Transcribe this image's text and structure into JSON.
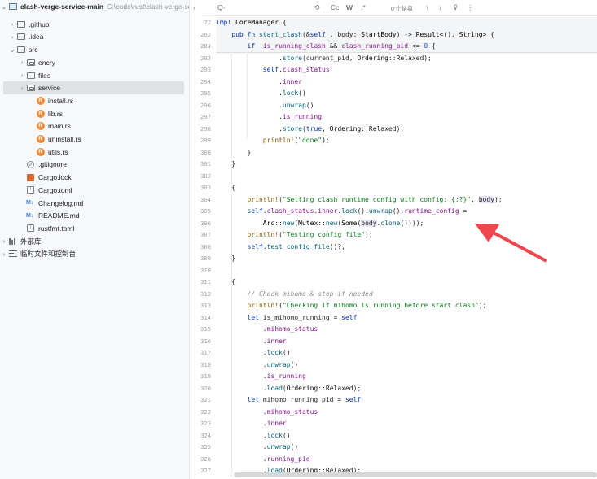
{
  "sidebar": {
    "root": {
      "label": "clash-verge-service-main",
      "path": "G:\\code\\rust\\clash-verge-se"
    },
    "items": [
      {
        "label": ".github",
        "kind": "folder",
        "depth": 1,
        "chevron": "›",
        "icon": "folder-icon"
      },
      {
        "label": ".idea",
        "kind": "folder",
        "depth": 1,
        "chevron": "›",
        "icon": "folder-icon"
      },
      {
        "label": "src",
        "kind": "folder",
        "depth": 1,
        "chevron": "⌄",
        "icon": "folder-icon"
      },
      {
        "label": "encry",
        "kind": "folder",
        "depth": 2,
        "chevron": "›",
        "icon": "package-icon"
      },
      {
        "label": "files",
        "kind": "folder",
        "depth": 2,
        "chevron": "›",
        "icon": "folder-icon"
      },
      {
        "label": "service",
        "kind": "folder",
        "depth": 2,
        "chevron": "›",
        "icon": "package-icon",
        "selected": true
      },
      {
        "label": "install.rs",
        "kind": "rust",
        "depth": 3,
        "icon": "rust-file-icon"
      },
      {
        "label": "lib.rs",
        "kind": "rust",
        "depth": 3,
        "icon": "rust-file-icon"
      },
      {
        "label": "main.rs",
        "kind": "rust",
        "depth": 3,
        "icon": "rust-file-icon"
      },
      {
        "label": "uninstall.rs",
        "kind": "rust",
        "depth": 3,
        "icon": "rust-file-icon"
      },
      {
        "label": "utils.rs",
        "kind": "rust",
        "depth": 3,
        "icon": "rust-file-icon"
      },
      {
        "label": ".gitignore",
        "kind": "ignore",
        "depth": 2,
        "icon": "gitignore-icon"
      },
      {
        "label": "Cargo.lock",
        "kind": "lock",
        "depth": 2,
        "icon": "cargo-lock-icon"
      },
      {
        "label": "Cargo.toml",
        "kind": "toml",
        "depth": 2,
        "icon": "toml-file-icon"
      },
      {
        "label": "Changelog.md",
        "kind": "md",
        "depth": 2,
        "icon": "markdown-icon"
      },
      {
        "label": "README.md",
        "kind": "md",
        "depth": 2,
        "icon": "markdown-icon"
      },
      {
        "label": "rustfmt.toml",
        "kind": "toml",
        "depth": 2,
        "icon": "toml-file-icon"
      },
      {
        "label": "外部库",
        "kind": "lib",
        "depth": 0,
        "chevron": "›",
        "icon": "external-libraries-icon"
      },
      {
        "label": "临时文件和控制台",
        "kind": "scratch",
        "depth": 0,
        "chevron": "›",
        "icon": "scratches-icon"
      }
    ]
  },
  "findbar": {
    "search_icon": "Q-",
    "results": "0 个结果",
    "icons": [
      "regex-revert-icon",
      "match-case-icon",
      "words-icon",
      "regex-icon",
      "prev-icon",
      "next-icon",
      "filter-icon",
      "more-icon"
    ],
    "labels": {
      "replace": "⟲",
      "case": "Cc",
      "words": "W",
      "regex": ".*",
      "up": "↑",
      "down": "↓",
      "filter": "⊽",
      "more": "⋮"
    }
  },
  "breadcrumb_chevron": "›",
  "editor": {
    "sticky_lines": [
      {
        "n": "72",
        "tokens": [
          [
            "kw",
            "impl "
          ],
          [
            "ty",
            "CoreManager "
          ],
          [
            "",
            "{"
          ]
        ]
      },
      {
        "n": "262",
        "tokens": [
          [
            "",
            "    "
          ],
          [
            "kw",
            "pub fn "
          ],
          [
            "fn",
            "start_clash"
          ],
          [
            "",
            "(&"
          ],
          [
            "kw",
            "self"
          ],
          [
            "",
            " , body: "
          ],
          [
            "ty",
            "StartBody"
          ],
          [
            "",
            ") -> "
          ],
          [
            "ty",
            "Result"
          ],
          [
            "",
            "<(), "
          ],
          [
            "ty",
            "String"
          ],
          [
            "",
            "> {"
          ]
        ]
      },
      {
        "n": "284",
        "tokens": [
          [
            "",
            "        "
          ],
          [
            "kw",
            "if "
          ],
          [
            "",
            "!"
          ],
          [
            "fld",
            "is_running_clash "
          ],
          [
            "",
            "&& "
          ],
          [
            "fld",
            "clash_running_pid "
          ],
          [
            "",
            "<= "
          ],
          [
            "num",
            "0 "
          ],
          [
            "",
            "{"
          ]
        ]
      }
    ],
    "lines": [
      {
        "n": "292",
        "tokens": [
          [
            "",
            "                "
          ],
          [
            "",
            "."
          ],
          [
            "fn",
            "store"
          ],
          [
            "",
            "(current_pid, "
          ],
          [
            "ty",
            "Ordering"
          ],
          [
            "",
            "::Relaxed);"
          ]
        ]
      },
      {
        "n": "293",
        "tokens": [
          [
            "",
            "            "
          ],
          [
            "kw",
            "self"
          ],
          [
            "",
            "."
          ],
          [
            "fld",
            "clash_status"
          ]
        ]
      },
      {
        "n": "294",
        "tokens": [
          [
            "",
            "                ."
          ],
          [
            "fld",
            "inner"
          ]
        ]
      },
      {
        "n": "295",
        "tokens": [
          [
            "",
            "                ."
          ],
          [
            "fn",
            "lock"
          ],
          [
            "",
            "()"
          ]
        ]
      },
      {
        "n": "296",
        "tokens": [
          [
            "",
            "                ."
          ],
          [
            "fn",
            "unwrap"
          ],
          [
            "",
            "()"
          ]
        ]
      },
      {
        "n": "297",
        "tokens": [
          [
            "",
            "                ."
          ],
          [
            "fld",
            "is_running"
          ]
        ]
      },
      {
        "n": "298",
        "tokens": [
          [
            "",
            "                ."
          ],
          [
            "fn",
            "store"
          ],
          [
            "",
            "("
          ],
          [
            "kw",
            "true"
          ],
          [
            "",
            ", "
          ],
          [
            "ty",
            "Ordering"
          ],
          [
            "",
            "::Relaxed);"
          ]
        ]
      },
      {
        "n": "299",
        "tokens": [
          [
            "",
            "            "
          ],
          [
            "mac",
            "println!"
          ],
          [
            "",
            "("
          ],
          [
            "str",
            "\"done\""
          ],
          [
            "",
            ");"
          ]
        ]
      },
      {
        "n": "300",
        "tokens": [
          [
            "",
            "        }"
          ]
        ]
      },
      {
        "n": "301",
        "tokens": [
          [
            "",
            "    }"
          ]
        ]
      },
      {
        "n": "302",
        "tokens": [
          [
            "",
            ""
          ]
        ]
      },
      {
        "n": "303",
        "tokens": [
          [
            "",
            "    {"
          ]
        ]
      },
      {
        "n": "304",
        "tokens": [
          [
            "",
            "        "
          ],
          [
            "mac",
            "println!"
          ],
          [
            "",
            "("
          ],
          [
            "str",
            "\"Setting clash runtime config with config: {:?}\""
          ],
          [
            "",
            ", "
          ],
          [
            "hl",
            "body"
          ],
          [
            "",
            ");"
          ]
        ]
      },
      {
        "n": "305",
        "tokens": [
          [
            "",
            "        "
          ],
          [
            "kw",
            "self"
          ],
          [
            "",
            "."
          ],
          [
            "fld",
            "clash_status"
          ],
          [
            "",
            "."
          ],
          [
            "fld",
            "inner"
          ],
          [
            "",
            "."
          ],
          [
            "fn",
            "lock"
          ],
          [
            "",
            "()."
          ],
          [
            "fn",
            "unwrap"
          ],
          [
            "",
            "()."
          ],
          [
            "fld",
            "runtime_config"
          ],
          [
            "",
            " ="
          ]
        ]
      },
      {
        "n": "306",
        "tokens": [
          [
            "",
            "            "
          ],
          [
            "ty",
            "Arc"
          ],
          [
            "",
            "::"
          ],
          [
            "fn",
            "new"
          ],
          [
            "",
            "("
          ],
          [
            "ty",
            "Mutex"
          ],
          [
            "",
            "::"
          ],
          [
            "fn",
            "new"
          ],
          [
            "",
            "("
          ],
          [
            "ty",
            "Some"
          ],
          [
            "",
            "("
          ],
          [
            "hl",
            "body"
          ],
          [
            "",
            "."
          ],
          [
            "fn",
            "clone"
          ],
          [
            "",
            "())));"
          ]
        ]
      },
      {
        "n": "307",
        "tokens": [
          [
            "",
            "        "
          ],
          [
            "mac",
            "println!"
          ],
          [
            "",
            "("
          ],
          [
            "str",
            "\"Testing config file\""
          ],
          [
            "",
            ");"
          ]
        ]
      },
      {
        "n": "308",
        "tokens": [
          [
            "",
            "        "
          ],
          [
            "kw",
            "self"
          ],
          [
            "",
            "."
          ],
          [
            "fn",
            "test_config_file"
          ],
          [
            "",
            "()?;"
          ]
        ]
      },
      {
        "n": "309",
        "tokens": [
          [
            "",
            "    }"
          ]
        ]
      },
      {
        "n": "310",
        "tokens": [
          [
            "",
            ""
          ]
        ]
      },
      {
        "n": "311",
        "tokens": [
          [
            "",
            "    {"
          ]
        ]
      },
      {
        "n": "312",
        "tokens": [
          [
            "",
            "        "
          ],
          [
            "com",
            "// Check mihomo & stop if needed"
          ]
        ]
      },
      {
        "n": "313",
        "tokens": [
          [
            "",
            "        "
          ],
          [
            "mac",
            "println!"
          ],
          [
            "",
            "("
          ],
          [
            "str",
            "\"Checking if mihomo is running before start clash\""
          ],
          [
            "",
            ");"
          ]
        ]
      },
      {
        "n": "314",
        "tokens": [
          [
            "",
            "        "
          ],
          [
            "kw",
            "let "
          ],
          [
            "",
            "is_mihomo_running = "
          ],
          [
            "kw",
            "self"
          ]
        ]
      },
      {
        "n": "315",
        "tokens": [
          [
            "",
            "            ."
          ],
          [
            "fld",
            "mihomo_status"
          ]
        ]
      },
      {
        "n": "316",
        "tokens": [
          [
            "",
            "            ."
          ],
          [
            "fld",
            "inner"
          ]
        ]
      },
      {
        "n": "317",
        "tokens": [
          [
            "",
            "            ."
          ],
          [
            "fn",
            "lock"
          ],
          [
            "",
            "()"
          ]
        ]
      },
      {
        "n": "318",
        "tokens": [
          [
            "",
            "            ."
          ],
          [
            "fn",
            "unwrap"
          ],
          [
            "",
            "()"
          ]
        ]
      },
      {
        "n": "319",
        "tokens": [
          [
            "",
            "            ."
          ],
          [
            "fld",
            "is_running"
          ]
        ]
      },
      {
        "n": "320",
        "tokens": [
          [
            "",
            "            ."
          ],
          [
            "fn",
            "load"
          ],
          [
            "",
            "("
          ],
          [
            "ty",
            "Ordering"
          ],
          [
            "",
            "::Relaxed);"
          ]
        ]
      },
      {
        "n": "321",
        "tokens": [
          [
            "",
            "        "
          ],
          [
            "kw",
            "let "
          ],
          [
            "",
            "mihomo_running_pid = "
          ],
          [
            "kw",
            "self"
          ]
        ]
      },
      {
        "n": "322",
        "tokens": [
          [
            "",
            "            ."
          ],
          [
            "fld",
            "mihomo_status"
          ]
        ]
      },
      {
        "n": "323",
        "tokens": [
          [
            "",
            "            ."
          ],
          [
            "fld",
            "inner"
          ]
        ]
      },
      {
        "n": "324",
        "tokens": [
          [
            "",
            "            ."
          ],
          [
            "fn",
            "lock"
          ],
          [
            "",
            "()"
          ]
        ]
      },
      {
        "n": "325",
        "tokens": [
          [
            "",
            "            ."
          ],
          [
            "fn",
            "unwrap"
          ],
          [
            "",
            "()"
          ]
        ]
      },
      {
        "n": "326",
        "tokens": [
          [
            "",
            "            ."
          ],
          [
            "fld",
            "running_pid"
          ]
        ]
      },
      {
        "n": "327",
        "tokens": [
          [
            "",
            "            ."
          ],
          [
            "fn",
            "load"
          ],
          [
            "",
            "("
          ],
          [
            "ty",
            "Ordering"
          ],
          [
            "",
            "::Relaxed);"
          ]
        ]
      }
    ]
  },
  "colors": {
    "arrow": "#f0464e",
    "selection": "#dfe1e5",
    "sidebar_bg": "#f7f8fa"
  }
}
